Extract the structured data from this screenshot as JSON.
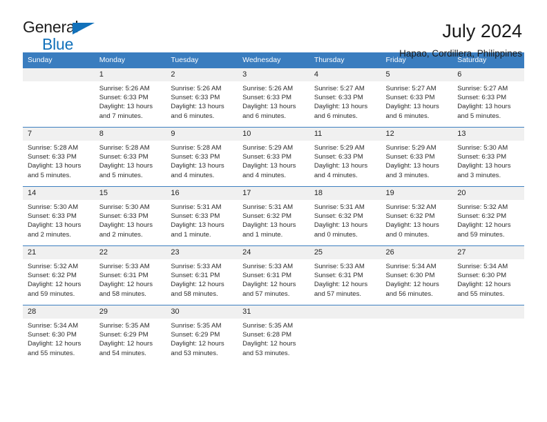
{
  "brand": {
    "name_part1": "General",
    "name_part2": "Blue"
  },
  "header": {
    "title": "July 2024",
    "subtitle": "Hapao, Cordillera, Philippines"
  },
  "theme": {
    "header_blue": "#3a7dbf",
    "logo_blue": "#1271ba",
    "daynum_band": "#f0f0f0",
    "text": "#1a1a1a"
  },
  "weekday_headers": [
    "Sunday",
    "Monday",
    "Tuesday",
    "Wednesday",
    "Thursday",
    "Friday",
    "Saturday"
  ],
  "weeks": [
    [
      {
        "day": "",
        "sunrise": "",
        "sunset": "",
        "daylight1": "",
        "daylight2": ""
      },
      {
        "day": "1",
        "sunrise": "Sunrise: 5:26 AM",
        "sunset": "Sunset: 6:33 PM",
        "daylight1": "Daylight: 13 hours",
        "daylight2": "and 7 minutes."
      },
      {
        "day": "2",
        "sunrise": "Sunrise: 5:26 AM",
        "sunset": "Sunset: 6:33 PM",
        "daylight1": "Daylight: 13 hours",
        "daylight2": "and 6 minutes."
      },
      {
        "day": "3",
        "sunrise": "Sunrise: 5:26 AM",
        "sunset": "Sunset: 6:33 PM",
        "daylight1": "Daylight: 13 hours",
        "daylight2": "and 6 minutes."
      },
      {
        "day": "4",
        "sunrise": "Sunrise: 5:27 AM",
        "sunset": "Sunset: 6:33 PM",
        "daylight1": "Daylight: 13 hours",
        "daylight2": "and 6 minutes."
      },
      {
        "day": "5",
        "sunrise": "Sunrise: 5:27 AM",
        "sunset": "Sunset: 6:33 PM",
        "daylight1": "Daylight: 13 hours",
        "daylight2": "and 6 minutes."
      },
      {
        "day": "6",
        "sunrise": "Sunrise: 5:27 AM",
        "sunset": "Sunset: 6:33 PM",
        "daylight1": "Daylight: 13 hours",
        "daylight2": "and 5 minutes."
      }
    ],
    [
      {
        "day": "7",
        "sunrise": "Sunrise: 5:28 AM",
        "sunset": "Sunset: 6:33 PM",
        "daylight1": "Daylight: 13 hours",
        "daylight2": "and 5 minutes."
      },
      {
        "day": "8",
        "sunrise": "Sunrise: 5:28 AM",
        "sunset": "Sunset: 6:33 PM",
        "daylight1": "Daylight: 13 hours",
        "daylight2": "and 5 minutes."
      },
      {
        "day": "9",
        "sunrise": "Sunrise: 5:28 AM",
        "sunset": "Sunset: 6:33 PM",
        "daylight1": "Daylight: 13 hours",
        "daylight2": "and 4 minutes."
      },
      {
        "day": "10",
        "sunrise": "Sunrise: 5:29 AM",
        "sunset": "Sunset: 6:33 PM",
        "daylight1": "Daylight: 13 hours",
        "daylight2": "and 4 minutes."
      },
      {
        "day": "11",
        "sunrise": "Sunrise: 5:29 AM",
        "sunset": "Sunset: 6:33 PM",
        "daylight1": "Daylight: 13 hours",
        "daylight2": "and 4 minutes."
      },
      {
        "day": "12",
        "sunrise": "Sunrise: 5:29 AM",
        "sunset": "Sunset: 6:33 PM",
        "daylight1": "Daylight: 13 hours",
        "daylight2": "and 3 minutes."
      },
      {
        "day": "13",
        "sunrise": "Sunrise: 5:30 AM",
        "sunset": "Sunset: 6:33 PM",
        "daylight1": "Daylight: 13 hours",
        "daylight2": "and 3 minutes."
      }
    ],
    [
      {
        "day": "14",
        "sunrise": "Sunrise: 5:30 AM",
        "sunset": "Sunset: 6:33 PM",
        "daylight1": "Daylight: 13 hours",
        "daylight2": "and 2 minutes."
      },
      {
        "day": "15",
        "sunrise": "Sunrise: 5:30 AM",
        "sunset": "Sunset: 6:33 PM",
        "daylight1": "Daylight: 13 hours",
        "daylight2": "and 2 minutes."
      },
      {
        "day": "16",
        "sunrise": "Sunrise: 5:31 AM",
        "sunset": "Sunset: 6:33 PM",
        "daylight1": "Daylight: 13 hours",
        "daylight2": "and 1 minute."
      },
      {
        "day": "17",
        "sunrise": "Sunrise: 5:31 AM",
        "sunset": "Sunset: 6:32 PM",
        "daylight1": "Daylight: 13 hours",
        "daylight2": "and 1 minute."
      },
      {
        "day": "18",
        "sunrise": "Sunrise: 5:31 AM",
        "sunset": "Sunset: 6:32 PM",
        "daylight1": "Daylight: 13 hours",
        "daylight2": "and 0 minutes."
      },
      {
        "day": "19",
        "sunrise": "Sunrise: 5:32 AM",
        "sunset": "Sunset: 6:32 PM",
        "daylight1": "Daylight: 13 hours",
        "daylight2": "and 0 minutes."
      },
      {
        "day": "20",
        "sunrise": "Sunrise: 5:32 AM",
        "sunset": "Sunset: 6:32 PM",
        "daylight1": "Daylight: 12 hours",
        "daylight2": "and 59 minutes."
      }
    ],
    [
      {
        "day": "21",
        "sunrise": "Sunrise: 5:32 AM",
        "sunset": "Sunset: 6:32 PM",
        "daylight1": "Daylight: 12 hours",
        "daylight2": "and 59 minutes."
      },
      {
        "day": "22",
        "sunrise": "Sunrise: 5:33 AM",
        "sunset": "Sunset: 6:31 PM",
        "daylight1": "Daylight: 12 hours",
        "daylight2": "and 58 minutes."
      },
      {
        "day": "23",
        "sunrise": "Sunrise: 5:33 AM",
        "sunset": "Sunset: 6:31 PM",
        "daylight1": "Daylight: 12 hours",
        "daylight2": "and 58 minutes."
      },
      {
        "day": "24",
        "sunrise": "Sunrise: 5:33 AM",
        "sunset": "Sunset: 6:31 PM",
        "daylight1": "Daylight: 12 hours",
        "daylight2": "and 57 minutes."
      },
      {
        "day": "25",
        "sunrise": "Sunrise: 5:33 AM",
        "sunset": "Sunset: 6:31 PM",
        "daylight1": "Daylight: 12 hours",
        "daylight2": "and 57 minutes."
      },
      {
        "day": "26",
        "sunrise": "Sunrise: 5:34 AM",
        "sunset": "Sunset: 6:30 PM",
        "daylight1": "Daylight: 12 hours",
        "daylight2": "and 56 minutes."
      },
      {
        "day": "27",
        "sunrise": "Sunrise: 5:34 AM",
        "sunset": "Sunset: 6:30 PM",
        "daylight1": "Daylight: 12 hours",
        "daylight2": "and 55 minutes."
      }
    ],
    [
      {
        "day": "28",
        "sunrise": "Sunrise: 5:34 AM",
        "sunset": "Sunset: 6:30 PM",
        "daylight1": "Daylight: 12 hours",
        "daylight2": "and 55 minutes."
      },
      {
        "day": "29",
        "sunrise": "Sunrise: 5:35 AM",
        "sunset": "Sunset: 6:29 PM",
        "daylight1": "Daylight: 12 hours",
        "daylight2": "and 54 minutes."
      },
      {
        "day": "30",
        "sunrise": "Sunrise: 5:35 AM",
        "sunset": "Sunset: 6:29 PM",
        "daylight1": "Daylight: 12 hours",
        "daylight2": "and 53 minutes."
      },
      {
        "day": "31",
        "sunrise": "Sunrise: 5:35 AM",
        "sunset": "Sunset: 6:28 PM",
        "daylight1": "Daylight: 12 hours",
        "daylight2": "and 53 minutes."
      },
      {
        "day": "",
        "sunrise": "",
        "sunset": "",
        "daylight1": "",
        "daylight2": ""
      },
      {
        "day": "",
        "sunrise": "",
        "sunset": "",
        "daylight1": "",
        "daylight2": ""
      },
      {
        "day": "",
        "sunrise": "",
        "sunset": "",
        "daylight1": "",
        "daylight2": ""
      }
    ]
  ]
}
